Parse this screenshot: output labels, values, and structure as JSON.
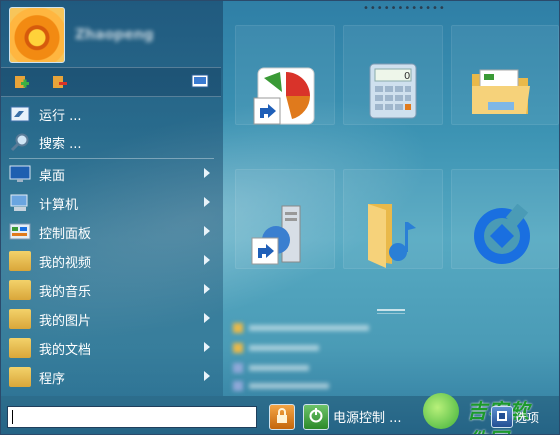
{
  "user": {
    "name": "Zhaopeng"
  },
  "toolbar": {
    "add_icon": "app-add-icon",
    "remove_icon": "app-remove-icon",
    "display_icon": "display-icon"
  },
  "menu": {
    "top": [
      {
        "label": "运行 ...",
        "icon": "run-icon"
      },
      {
        "label": "搜索 ...",
        "icon": "search-icon"
      }
    ],
    "items": [
      {
        "label": "桌面",
        "icon": "desktop-icon"
      },
      {
        "label": "计算机",
        "icon": "computer-icon"
      },
      {
        "label": "控制面板",
        "icon": "control-panel-icon"
      },
      {
        "label": "我的视频",
        "icon": "videos-folder-icon"
      },
      {
        "label": "我的音乐",
        "icon": "music-folder-icon"
      },
      {
        "label": "我的图片",
        "icon": "pictures-folder-icon"
      },
      {
        "label": "我的文档",
        "icon": "documents-folder-icon"
      },
      {
        "label": "程序",
        "icon": "programs-folder-icon"
      }
    ]
  },
  "tiles": [
    {
      "icon": "chart-shortcut-icon"
    },
    {
      "icon": "calculator-icon",
      "display": "0"
    },
    {
      "icon": "file-explorer-icon"
    },
    {
      "icon": "network-server-shortcut-icon"
    },
    {
      "icon": "music-folder-icon"
    },
    {
      "icon": "ccb-bank-logo-icon"
    }
  ],
  "bottom": {
    "search_value": "",
    "lock_icon": "lock-icon",
    "power_label": "电源控制 ...",
    "options_label": "选项",
    "watermark": "吉客软件园"
  },
  "colors": {
    "bank_blue": "#1a6fe0",
    "accent_orange": "#e07a1c",
    "power_green": "#3a9a36"
  }
}
